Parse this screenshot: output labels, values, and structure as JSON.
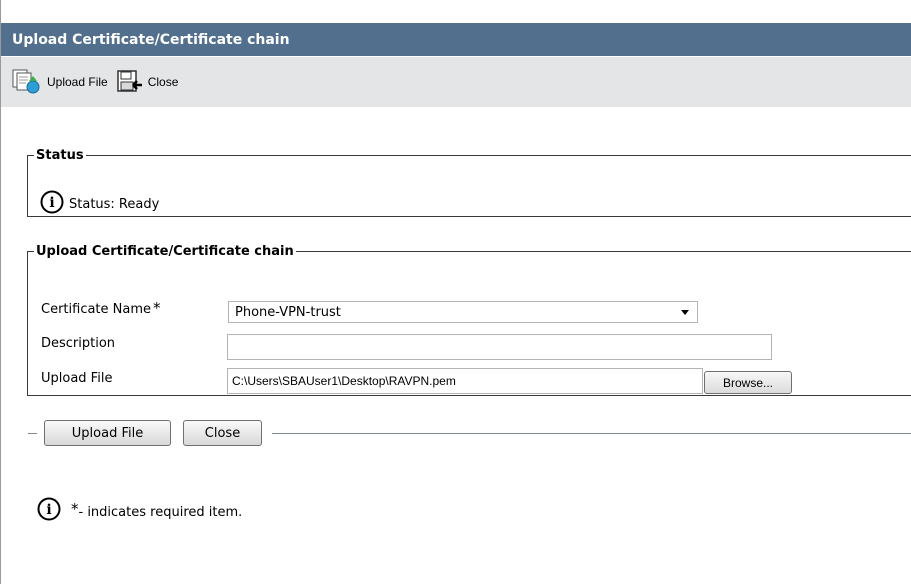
{
  "header": {
    "title": "Upload Certificate/Certificate chain"
  },
  "toolbar": {
    "upload_label": "Upload File",
    "close_label": "Close"
  },
  "status_section": {
    "legend": "Status",
    "text": "Status: Ready"
  },
  "upload_section": {
    "legend": "Upload Certificate/Certificate chain",
    "cert_name_label": "Certificate Name",
    "required_mark": "*",
    "cert_name_value": "Phone-VPN-trust",
    "description_label": "Description",
    "description_value": "",
    "file_label": "Upload File",
    "file_value": "C:\\Users\\SBAUser1\\Desktop\\RAVPN.pem",
    "browse_label": "Browse..."
  },
  "actions": {
    "upload_label": "Upload File",
    "close_label": "Close"
  },
  "footer_note": {
    "star": "*",
    "text": "- indicates required item."
  }
}
